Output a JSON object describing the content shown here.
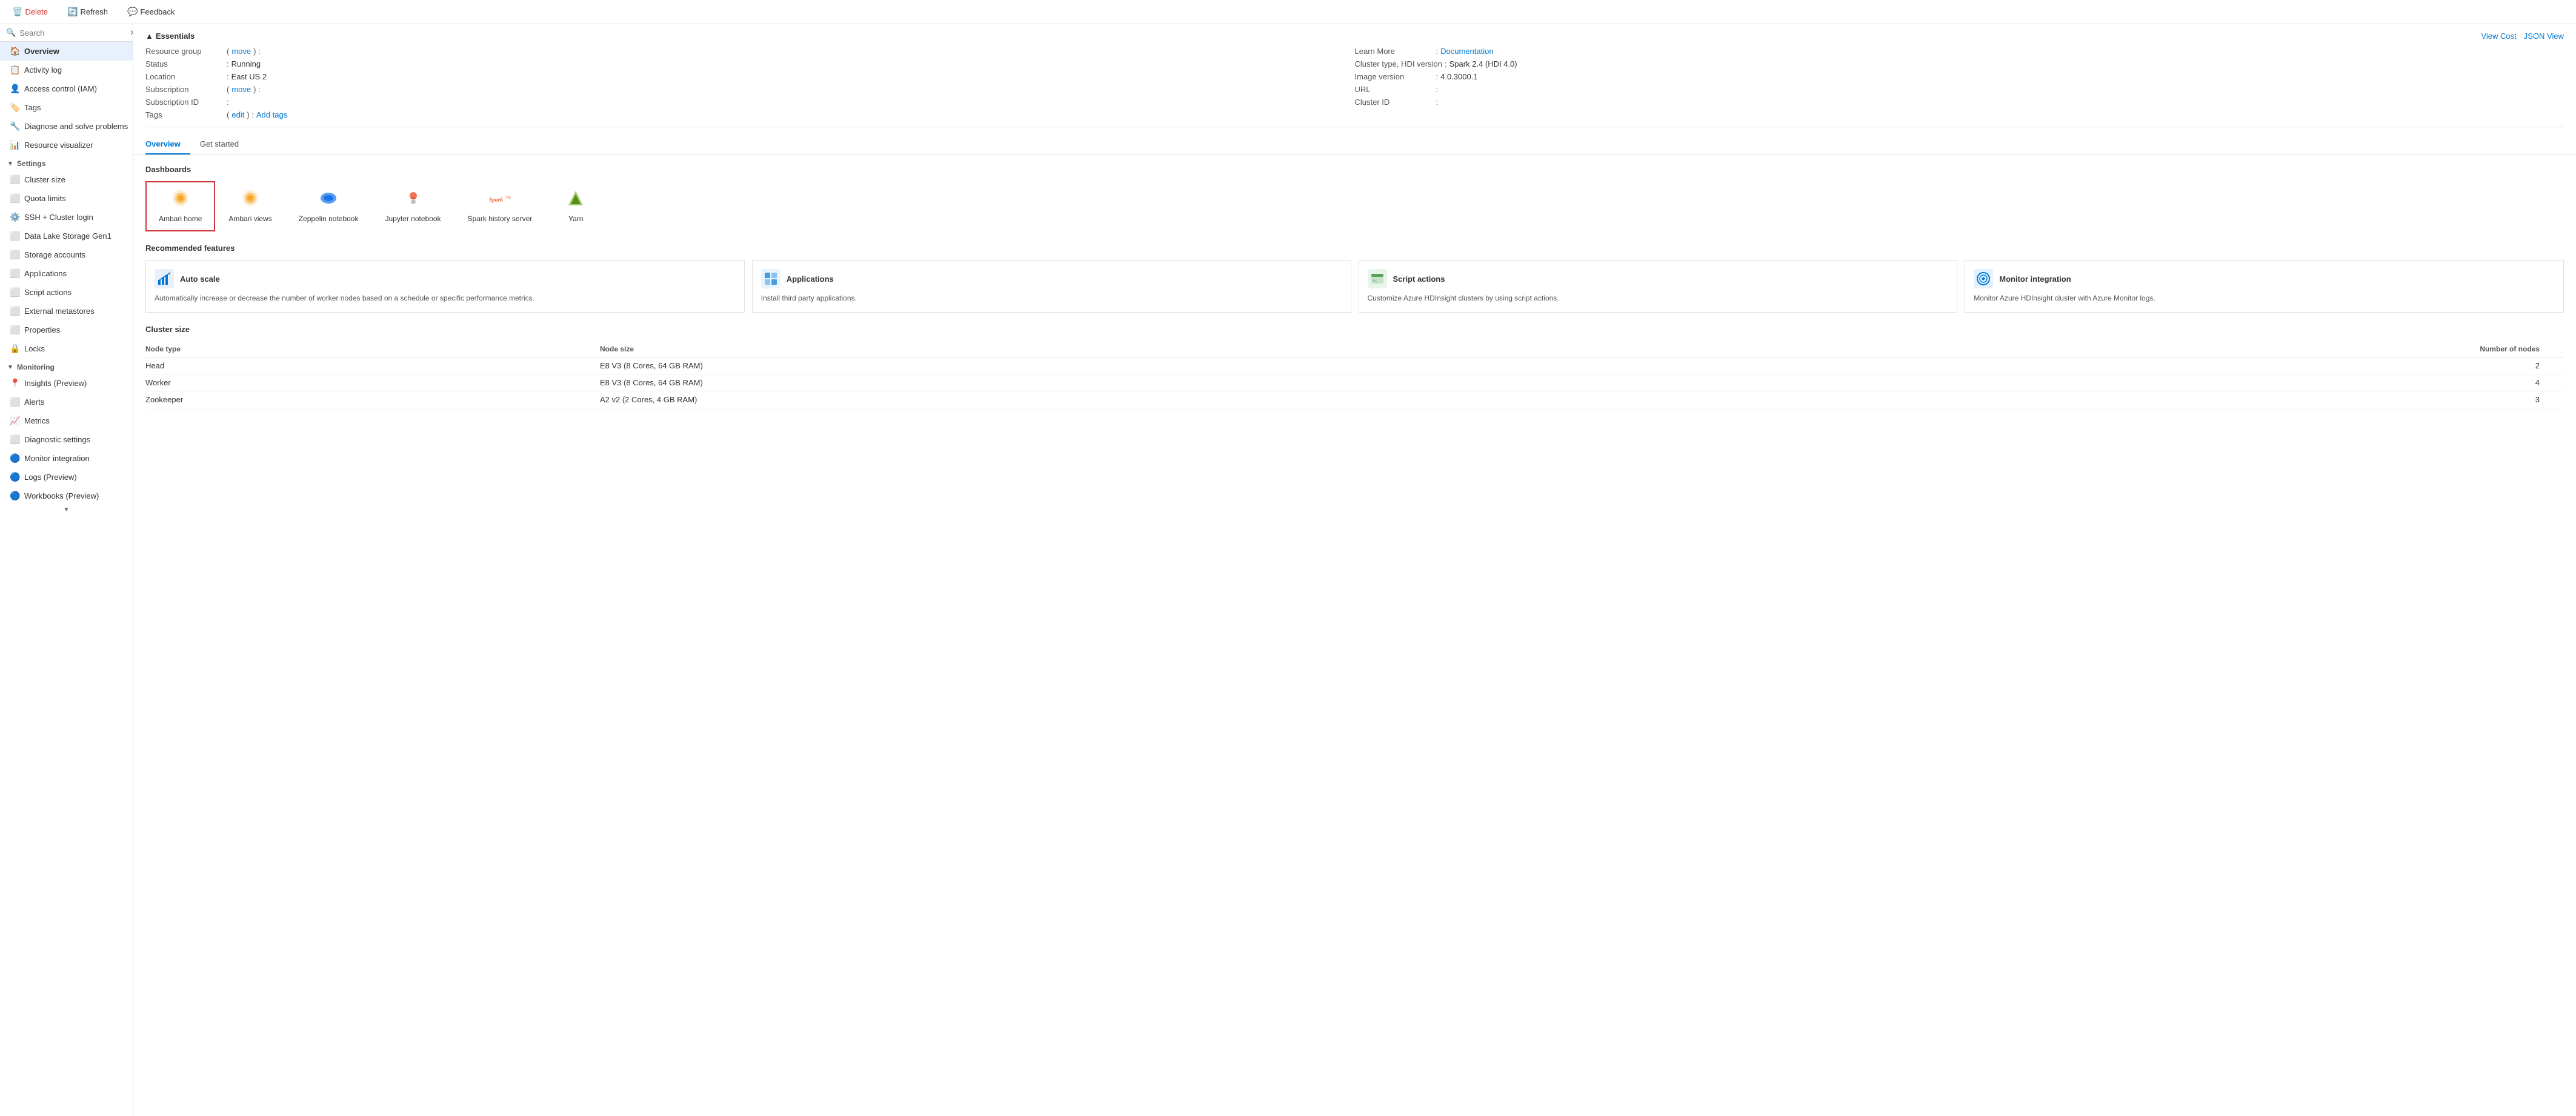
{
  "toolbar": {
    "delete_label": "Delete",
    "refresh_label": "Refresh",
    "feedback_label": "Feedback"
  },
  "sidebar": {
    "search_placeholder": "Search",
    "items": [
      {
        "id": "overview",
        "label": "Overview",
        "icon": "🏠",
        "active": true
      },
      {
        "id": "activity-log",
        "label": "Activity log",
        "icon": "📋"
      },
      {
        "id": "access-control",
        "label": "Access control (IAM)",
        "icon": "👤"
      },
      {
        "id": "tags",
        "label": "Tags",
        "icon": "🏷️"
      },
      {
        "id": "diagnose",
        "label": "Diagnose and solve problems",
        "icon": "🔧"
      },
      {
        "id": "resource-visualizer",
        "label": "Resource visualizer",
        "icon": "📊"
      }
    ],
    "settings_label": "Settings",
    "settings_items": [
      {
        "id": "cluster-size",
        "label": "Cluster size",
        "icon": "⬛"
      },
      {
        "id": "quota-limits",
        "label": "Quota limits",
        "icon": "⬛"
      },
      {
        "id": "ssh-login",
        "label": "SSH + Cluster login",
        "icon": "⚙️"
      },
      {
        "id": "data-lake",
        "label": "Data Lake Storage Gen1",
        "icon": "⬛"
      },
      {
        "id": "storage-accounts",
        "label": "Storage accounts",
        "icon": "⬛"
      },
      {
        "id": "applications",
        "label": "Applications",
        "icon": "⬛"
      },
      {
        "id": "script-actions",
        "label": "Script actions",
        "icon": "⬛"
      },
      {
        "id": "external-metastores",
        "label": "External metastores",
        "icon": "⬛"
      },
      {
        "id": "properties",
        "label": "Properties",
        "icon": "⬛"
      },
      {
        "id": "locks",
        "label": "Locks",
        "icon": "🔒"
      }
    ],
    "monitoring_label": "Monitoring",
    "monitoring_items": [
      {
        "id": "insights",
        "label": "Insights (Preview)",
        "icon": "📍"
      },
      {
        "id": "alerts",
        "label": "Alerts",
        "icon": "⬛"
      },
      {
        "id": "metrics",
        "label": "Metrics",
        "icon": "📈"
      },
      {
        "id": "diagnostic-settings",
        "label": "Diagnostic settings",
        "icon": "⬛"
      },
      {
        "id": "monitor-integration",
        "label": "Monitor integration",
        "icon": "🔵"
      },
      {
        "id": "logs",
        "label": "Logs (Preview)",
        "icon": "🔵"
      },
      {
        "id": "workbooks",
        "label": "Workbooks (Preview)",
        "icon": "🔵"
      }
    ]
  },
  "essentials": {
    "title": "Essentials",
    "view_cost_label": "View Cost",
    "json_view_label": "JSON View",
    "fields": {
      "resource_group_label": "Resource group",
      "resource_group_link": "move",
      "status_label": "Status",
      "status_value": "Running",
      "location_label": "Location",
      "location_value": "East US 2",
      "subscription_label": "Subscription",
      "subscription_link": "move",
      "subscription_id_label": "Subscription ID",
      "tags_label": "Tags",
      "tags_edit_link": "edit",
      "tags_add_link": "Add tags",
      "learn_more_label": "Learn More",
      "documentation_link": "Documentation",
      "cluster_type_label": "Cluster type, HDI version",
      "cluster_type_value": "Spark 2.4 (HDI 4.0)",
      "image_version_label": "Image version",
      "image_version_value": "4.0.3000.1",
      "url_label": "URL",
      "cluster_id_label": "Cluster ID"
    }
  },
  "tabs": [
    {
      "id": "overview",
      "label": "Overview",
      "active": true
    },
    {
      "id": "get-started",
      "label": "Get started",
      "active": false
    }
  ],
  "dashboards": {
    "title": "Dashboards",
    "items": [
      {
        "id": "ambari-home",
        "label": "Ambari home",
        "icon": "🟡",
        "selected": true
      },
      {
        "id": "ambari-views",
        "label": "Ambari views",
        "icon": "🟡",
        "selected": false
      },
      {
        "id": "zeppelin",
        "label": "Zeppelin notebook",
        "icon": "🔵",
        "selected": false
      },
      {
        "id": "jupyter",
        "label": "Jupyter notebook",
        "icon": "🟠",
        "selected": false
      },
      {
        "id": "spark-history",
        "label": "Spark history server",
        "icon": "⚡",
        "selected": false
      },
      {
        "id": "yarn",
        "label": "Yarn",
        "icon": "🟢",
        "selected": false
      }
    ]
  },
  "recommended": {
    "title": "Recommended features",
    "items": [
      {
        "id": "auto-scale",
        "title": "Auto scale",
        "icon": "📐",
        "description": "Automatically increase or decrease the number of worker nodes based on a schedule or specific performance metrics."
      },
      {
        "id": "applications",
        "title": "Applications",
        "icon": "📦",
        "description": "Install third party applications."
      },
      {
        "id": "script-actions",
        "title": "Script actions",
        "icon": "💻",
        "description": "Customize Azure HDInsight clusters by using script actions."
      },
      {
        "id": "monitor-integration",
        "title": "Monitor integration",
        "icon": "🔵",
        "description": "Monitor Azure HDInsight cluster with Azure Monitor logs."
      }
    ]
  },
  "cluster_size": {
    "title": "Cluster size",
    "columns": [
      "Node type",
      "Node size",
      "Number of nodes"
    ],
    "rows": [
      {
        "type": "Head",
        "size": "E8 V3 (8 Cores, 64 GB RAM)",
        "nodes": "2"
      },
      {
        "type": "Worker",
        "size": "E8 V3 (8 Cores, 64 GB RAM)",
        "nodes": "4"
      },
      {
        "type": "Zookeeper",
        "size": "A2 v2 (2 Cores, 4 GB RAM)",
        "nodes": "3"
      }
    ]
  }
}
